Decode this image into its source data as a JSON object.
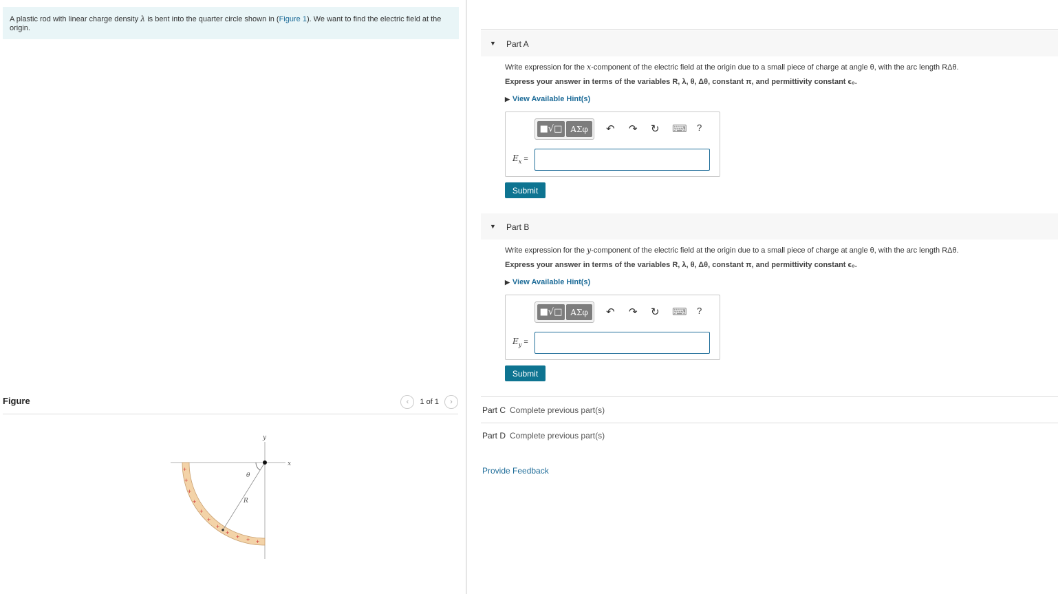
{
  "intro": {
    "text_before": "A plastic rod with linear charge density ",
    "lambda": "λ",
    "text_middle": " is bent into the quarter circle shown in (",
    "figure_link": "Figure 1",
    "text_after": "). We want to find the electric field at the origin."
  },
  "figure": {
    "title": "Figure",
    "pager_text": "1 of 1",
    "labels": {
      "x": "x",
      "y": "y",
      "theta": "θ",
      "R": "R",
      "plus": "+"
    }
  },
  "parts": [
    {
      "label": "Part A",
      "question_pre": "Write expression for the ",
      "question_var": "x",
      "question_post": "-component of the electric field at the origin due to a small piece of charge at angle θ, with the arc length RΔθ.",
      "instruction": "Express your answer in terms of the variables R, λ, θ, Δθ, constant π, and permittivity constant ϵ₀.",
      "hint": "View Available Hint(s)",
      "var_symbol": "E",
      "var_sub": "x",
      "var_eq": " =",
      "input_value": "",
      "submit": "Submit"
    },
    {
      "label": "Part B",
      "question_pre": "Write expression for the ",
      "question_var": "y",
      "question_post": "-component of the electric field at the origin due to a small piece of charge at angle θ, with the arc length RΔθ.",
      "instruction": "Express your answer in terms of the variables R, λ, θ, Δθ, constant π, and permittivity constant ϵ₀.",
      "hint": "View Available Hint(s)",
      "var_symbol": "E",
      "var_sub": "y",
      "var_eq": " =",
      "input_value": "",
      "submit": "Submit"
    }
  ],
  "toolbar": {
    "templates": "■√□",
    "symbols": "ΑΣφ",
    "undo": "↶",
    "redo": "↷",
    "reset": "↻",
    "keyboard": "⌨",
    "help": "?"
  },
  "locked_parts": [
    {
      "label": "Part C",
      "status": "Complete previous part(s)"
    },
    {
      "label": "Part D",
      "status": "Complete previous part(s)"
    }
  ],
  "feedback": "Provide Feedback",
  "colors": {
    "accent": "#0e7491",
    "link": "#1f6d99",
    "intro_bg": "#e9f5f7",
    "rod": "#f3d3a8"
  }
}
